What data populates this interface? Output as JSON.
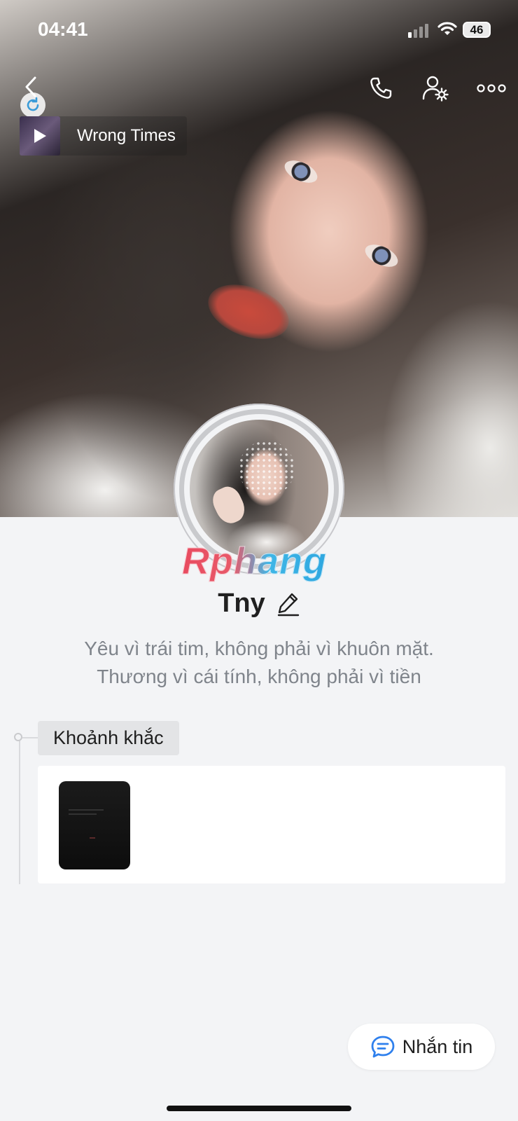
{
  "status_bar": {
    "time": "04:41",
    "battery": "46"
  },
  "nav": {
    "icons": [
      "back-icon",
      "phone-icon",
      "user-settings-icon",
      "more-icon",
      "refresh-icon"
    ]
  },
  "music": {
    "title": "Wrong Times",
    "icon": "play-icon"
  },
  "profile": {
    "name": "Tny",
    "watermark": "Rphang",
    "bio_line1": "Yêu vì trái tim, không phải vì khuôn mặt.",
    "bio_line2": "Thương vì cái tính, không phải vì tiền"
  },
  "moments": {
    "label": "Khoảnh khắc"
  },
  "message_button": {
    "label": "Nhắn tin",
    "icon": "chat-bubble-icon"
  },
  "colors": {
    "accent": "#2f80ed",
    "background": "#f3f4f6",
    "bio_text": "#7f848b"
  }
}
